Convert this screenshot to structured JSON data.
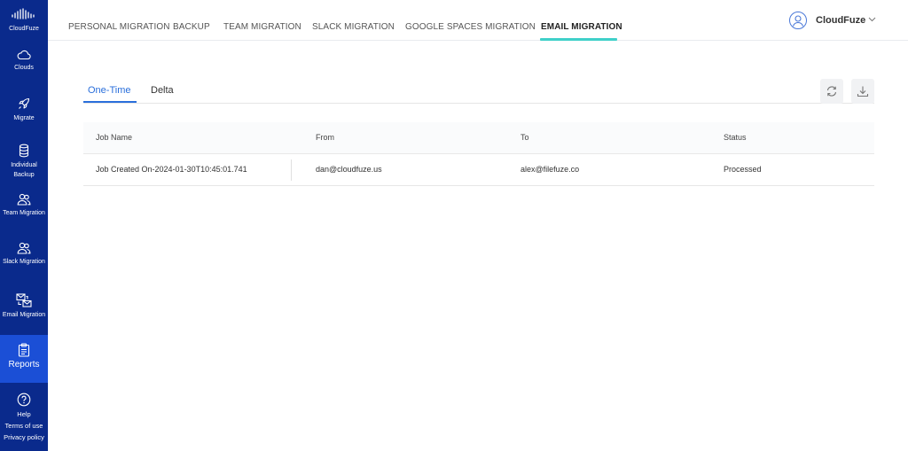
{
  "brand": {
    "name": "CloudFuze"
  },
  "sidebar": {
    "items": [
      {
        "label": "Clouds",
        "icon": "cloud-icon"
      },
      {
        "label": "Migrate",
        "icon": "rocket-icon"
      },
      {
        "label": "Individual Backup",
        "icon": "database-icon"
      },
      {
        "label": "Team Migration",
        "icon": "users-icon"
      },
      {
        "label": "Slack Migration",
        "icon": "users-icon"
      },
      {
        "label": "Email Migration",
        "icon": "email-migration-icon"
      },
      {
        "label": "Reports",
        "icon": "clipboard-icon",
        "active": true
      }
    ],
    "footer": {
      "help": "Help",
      "terms": "Terms of use",
      "privacy": "Privacy policy"
    }
  },
  "top_tabs": [
    {
      "label": "PERSONAL MIGRATION"
    },
    {
      "label": "BACKUP"
    },
    {
      "label": "TEAM MIGRATION"
    },
    {
      "label": "SLACK MIGRATION"
    },
    {
      "label": "GOOGLE SPACES MIGRATION"
    },
    {
      "label": "EMAIL MIGRATION",
      "active": true
    }
  ],
  "user": {
    "name": "CloudFuze"
  },
  "subtabs": [
    {
      "label": "One-Time",
      "active": true
    },
    {
      "label": "Delta"
    }
  ],
  "toolbar": {
    "refresh_icon": "refresh-icon",
    "download_icon": "download-icon"
  },
  "table": {
    "headers": [
      "Job Name",
      "From",
      "To",
      "Status"
    ],
    "rows": [
      [
        "Job Created On-2024-01-30T10:45:01.741",
        "dan@cloudfuze.us",
        "alex@filefuze.co",
        "Processed"
      ]
    ]
  },
  "colors": {
    "sidebar": "#0a2a8c",
    "sidebar_active": "#1b4fd6",
    "accent_underline": "#3fd0c9",
    "link_blue": "#2a6fdb"
  }
}
